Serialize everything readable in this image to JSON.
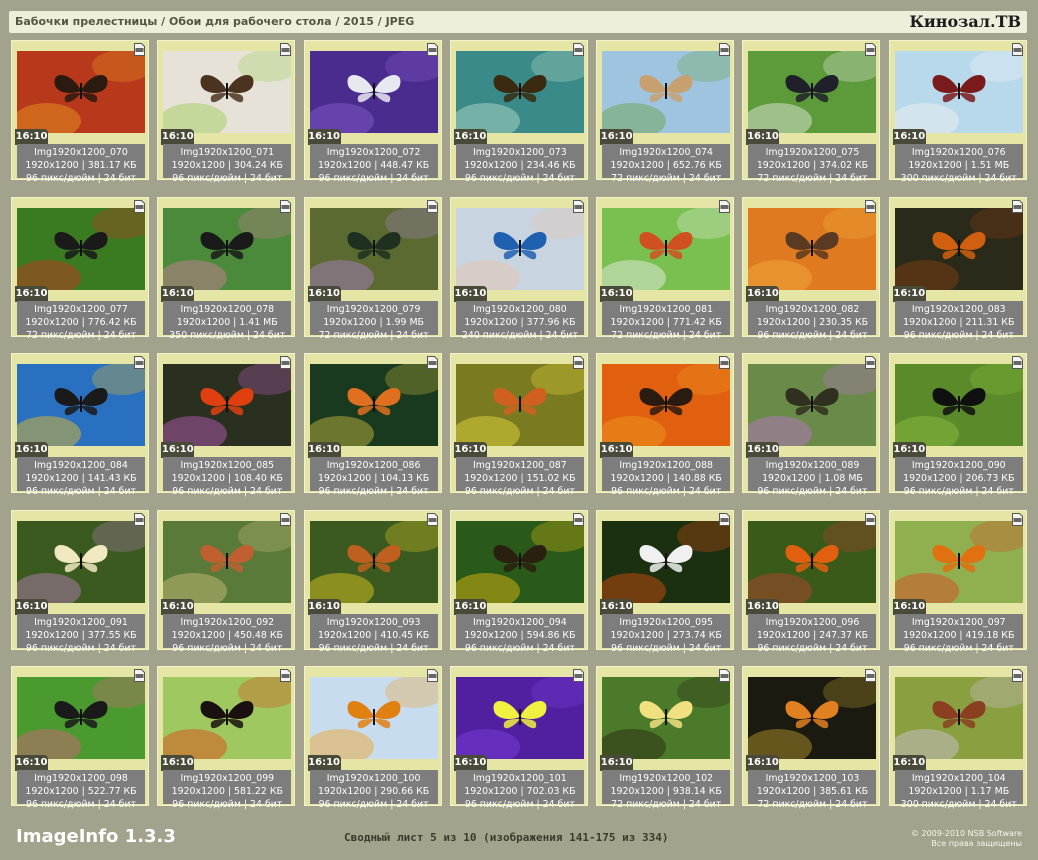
{
  "header": {
    "breadcrumb": "Бабочки прелестницы / Обои для рабочего стола / 2015 / JPEG",
    "brand": "Кинозал.ТВ"
  },
  "thumbnails": [
    {
      "name": "Img1920x1200_070",
      "dims": "1920x1200 | 381.17 КБ",
      "meta": "96 пикс/дюйм | 24 бит",
      "ratio": "16:10",
      "bg": "#b8381c",
      "fg": "#2a1a10",
      "accent": "#e8a020"
    },
    {
      "name": "Img1920x1200_071",
      "dims": "1920x1200 | 304.24 КБ",
      "meta": "96 пикс/дюйм | 24 бит",
      "ratio": "16:10",
      "bg": "#e6e2d8",
      "fg": "#4a3420",
      "accent": "#9acd50"
    },
    {
      "name": "Img1920x1200_072",
      "dims": "1920x1200 | 448.47 КБ",
      "meta": "96 пикс/дюйм | 24 бит",
      "ratio": "16:10",
      "bg": "#4a2c8e",
      "fg": "#e8e8f0",
      "accent": "#8a60d0"
    },
    {
      "name": "Img1920x1200_073",
      "dims": "1920x1200 | 234.46 КБ",
      "meta": "96 пикс/дюйм | 24 бит",
      "ratio": "16:10",
      "bg": "#3a8a8a",
      "fg": "#3a2a10",
      "accent": "#bfe0c8"
    },
    {
      "name": "Img1920x1200_074",
      "dims": "1920x1200 | 652.76 КБ",
      "meta": "72 пикс/дюйм | 24 бит",
      "ratio": "16:10",
      "bg": "#9ec4e0",
      "fg": "#c8a070",
      "accent": "#6aa040"
    },
    {
      "name": "Img1920x1200_075",
      "dims": "1920x1200 | 374.02 КБ",
      "meta": "72 пикс/дюйм | 24 бит",
      "ratio": "16:10",
      "bg": "#5c9a3a",
      "fg": "#20202a",
      "accent": "#f0f0f0"
    },
    {
      "name": "Img1920x1200_076",
      "dims": "1920x1200 | 1.51 МБ",
      "meta": "300 пикс/дюйм | 24 бит",
      "ratio": "16:10",
      "bg": "#b8d8ec",
      "fg": "#7a1a1a",
      "accent": "#f4f4f4"
    },
    {
      "name": "Img1920x1200_077",
      "dims": "1920x1200 | 776.42 КБ",
      "meta": "72 пикс/дюйм | 24 бит",
      "ratio": "16:10",
      "bg": "#3a7a20",
      "fg": "#1a1a1a",
      "accent": "#d03020"
    },
    {
      "name": "Img1920x1200_078",
      "dims": "1920x1200 | 1.41 МБ",
      "meta": "350 пикс/дюйм | 24 бит",
      "ratio": "16:10",
      "bg": "#4a8a3a",
      "fg": "#1a1a1a",
      "accent": "#d87aa0"
    },
    {
      "name": "Img1920x1200_079",
      "dims": "1920x1200 | 1.99 МБ",
      "meta": "72 пикс/дюйм | 24 бит",
      "ratio": "16:10",
      "bg": "#5a6a30",
      "fg": "#203020",
      "accent": "#b080d0"
    },
    {
      "name": "Img1920x1200_080",
      "dims": "1920x1200 | 377.96 КБ",
      "meta": "240 пикс/дюйм | 24 бит",
      "ratio": "16:10",
      "bg": "#c8d4e0",
      "fg": "#2060b0",
      "accent": "#e8c4a8"
    },
    {
      "name": "Img1920x1200_081",
      "dims": "1920x1200 | 771.42 КБ",
      "meta": "72 пикс/дюйм | 24 бит",
      "ratio": "16:10",
      "bg": "#7ac050",
      "fg": "#d05020",
      "accent": "#f0f0f0"
    },
    {
      "name": "Img1920x1200_082",
      "dims": "1920x1200 | 230.35 КБ",
      "meta": "96 пикс/дюйм | 24 бит",
      "ratio": "16:10",
      "bg": "#e07a20",
      "fg": "#5a3a20",
      "accent": "#f0b040"
    },
    {
      "name": "Img1920x1200_083",
      "dims": "1920x1200 | 211.31 КБ",
      "meta": "96 пикс/дюйм | 24 бит",
      "ratio": "16:10",
      "bg": "#2a2a1a",
      "fg": "#d06010",
      "accent": "#8a4010"
    },
    {
      "name": "Img1920x1200_084",
      "dims": "1920x1200 | 141.43 КБ",
      "meta": "96 пикс/дюйм | 24 бит",
      "ratio": "16:10",
      "bg": "#2a70c0",
      "fg": "#1a1a1a",
      "accent": "#f0c020"
    },
    {
      "name": "Img1920x1200_085",
      "dims": "1920x1200 | 108.40 КБ",
      "meta": "96 пикс/дюйм | 24 бит",
      "ratio": "16:10",
      "bg": "#2a3020",
      "fg": "#e04010",
      "accent": "#c060c0"
    },
    {
      "name": "Img1920x1200_086",
      "dims": "1920x1200 | 104.13 КБ",
      "meta": "96 пикс/дюйм | 24 бит",
      "ratio": "16:10",
      "bg": "#1a3a20",
      "fg": "#e07020",
      "accent": "#d0c040"
    },
    {
      "name": "Img1920x1200_087",
      "dims": "1920x1200 | 151.02 КБ",
      "meta": "96 пикс/дюйм | 24 бит",
      "ratio": "16:10",
      "bg": "#7a7a20",
      "fg": "#d06020",
      "accent": "#f0e040"
    },
    {
      "name": "Img1920x1200_088",
      "dims": "1920x1200 | 140.88 КБ",
      "meta": "96 пикс/дюйм | 24 бит",
      "ratio": "16:10",
      "bg": "#e06010",
      "fg": "#2a1a10",
      "accent": "#f0a020"
    },
    {
      "name": "Img1920x1200_089",
      "dims": "1920x1200 | 1.08 МБ",
      "meta": "96 пикс/дюйм | 24 бит",
      "ratio": "16:10",
      "bg": "#6a8a4a",
      "fg": "#303020",
      "accent": "#c070d0"
    },
    {
      "name": "Img1920x1200_090",
      "dims": "1920x1200 | 206.73 КБ",
      "meta": "96 пикс/дюйм | 24 бит",
      "ratio": "16:10",
      "bg": "#5a8a2a",
      "fg": "#101010",
      "accent": "#90c040"
    },
    {
      "name": "Img1920x1200_091",
      "dims": "1920x1200 | 377.55 КБ",
      "meta": "96 пикс/дюйм | 24 бит",
      "ratio": "16:10",
      "bg": "#3a5a20",
      "fg": "#f0e8c0",
      "accent": "#c080c0"
    },
    {
      "name": "Img1920x1200_092",
      "dims": "1920x1200 | 450.48 КБ",
      "meta": "96 пикс/дюйм | 24 бит",
      "ratio": "16:10",
      "bg": "#5a7a3a",
      "fg": "#c06030",
      "accent": "#d0c080"
    },
    {
      "name": "Img1920x1200_093",
      "dims": "1920x1200 | 410.45 КБ",
      "meta": "96 пикс/дюйм | 24 бит",
      "ratio": "16:10",
      "bg": "#3a5a20",
      "fg": "#c06020",
      "accent": "#f0d020"
    },
    {
      "name": "Img1920x1200_094",
      "dims": "1920x1200 | 594.86 КБ",
      "meta": "96 пикс/дюйм | 24 бит",
      "ratio": "16:10",
      "bg": "#2a5a1a",
      "fg": "#2a2010",
      "accent": "#f0c010"
    },
    {
      "name": "Img1920x1200_095",
      "dims": "1920x1200 | 273.74 КБ",
      "meta": "96 пикс/дюйм | 24 бит",
      "ratio": "16:10",
      "bg": "#1a3010",
      "fg": "#f0f0f0",
      "accent": "#e05010"
    },
    {
      "name": "Img1920x1200_096",
      "dims": "1920x1200 | 247.37 КБ",
      "meta": "96 пикс/дюйм | 24 бит",
      "ratio": "16:10",
      "bg": "#3a5a1a",
      "fg": "#e06010",
      "accent": "#c04030"
    },
    {
      "name": "Img1920x1200_097",
      "dims": "1920x1200 | 419.18 КБ",
      "meta": "96 пикс/дюйм | 24 бит",
      "ratio": "16:10",
      "bg": "#90b050",
      "fg": "#e07010",
      "accent": "#e04020"
    },
    {
      "name": "Img1920x1200_098",
      "dims": "1920x1200 | 522.77 КБ",
      "meta": "96 пикс/дюйм | 24 бит",
      "ratio": "16:10",
      "bg": "#4a9a30",
      "fg": "#1a1a1a",
      "accent": "#e06080"
    },
    {
      "name": "Img1920x1200_099",
      "dims": "1920x1200 | 581.22 КБ",
      "meta": "96 пикс/дюйм | 24 бит",
      "ratio": "16:10",
      "bg": "#a0c860",
      "fg": "#1a1010",
      "accent": "#e04010"
    },
    {
      "name": "Img1920x1200_100",
      "dims": "1920x1200 | 290.66 КБ",
      "meta": "96 пикс/дюйм | 24 бит",
      "ratio": "16:10",
      "bg": "#c8dcf0",
      "fg": "#e08010",
      "accent": "#f0a020"
    },
    {
      "name": "Img1920x1200_101",
      "dims": "1920x1200 | 702.03 КБ",
      "meta": "96 пикс/дюйм | 24 бит",
      "ratio": "16:10",
      "bg": "#5020a0",
      "fg": "#f0f040",
      "accent": "#8040e0"
    },
    {
      "name": "Img1920x1200_102",
      "dims": "1920x1200 | 938.14 КБ",
      "meta": "72 пикс/дюйм | 24 бит",
      "ratio": "16:10",
      "bg": "#4a7a2a",
      "fg": "#f0e080",
      "accent": "#2a2010"
    },
    {
      "name": "Img1920x1200_103",
      "dims": "1920x1200 | 385.61 КБ",
      "meta": "72 пикс/дюйм | 24 бит",
      "ratio": "16:10",
      "bg": "#1a1a10",
      "fg": "#e08020",
      "accent": "#c0a030"
    },
    {
      "name": "Img1920x1200_104",
      "dims": "1920x1200 | 1.17 МБ",
      "meta": "300 пикс/дюйм | 24 бит",
      "ratio": "16:10",
      "bg": "#8aa040",
      "fg": "#8a4020",
      "accent": "#d0c0e0"
    }
  ],
  "footer": {
    "app_name": "ImageInfo 1.3.3",
    "summary": "Сводный лист 5 из 10 (изображения 141-175 из 334)",
    "copyright_line1": "© 2009-2010 NSB Software",
    "copyright_line2": "Все права защищены"
  }
}
